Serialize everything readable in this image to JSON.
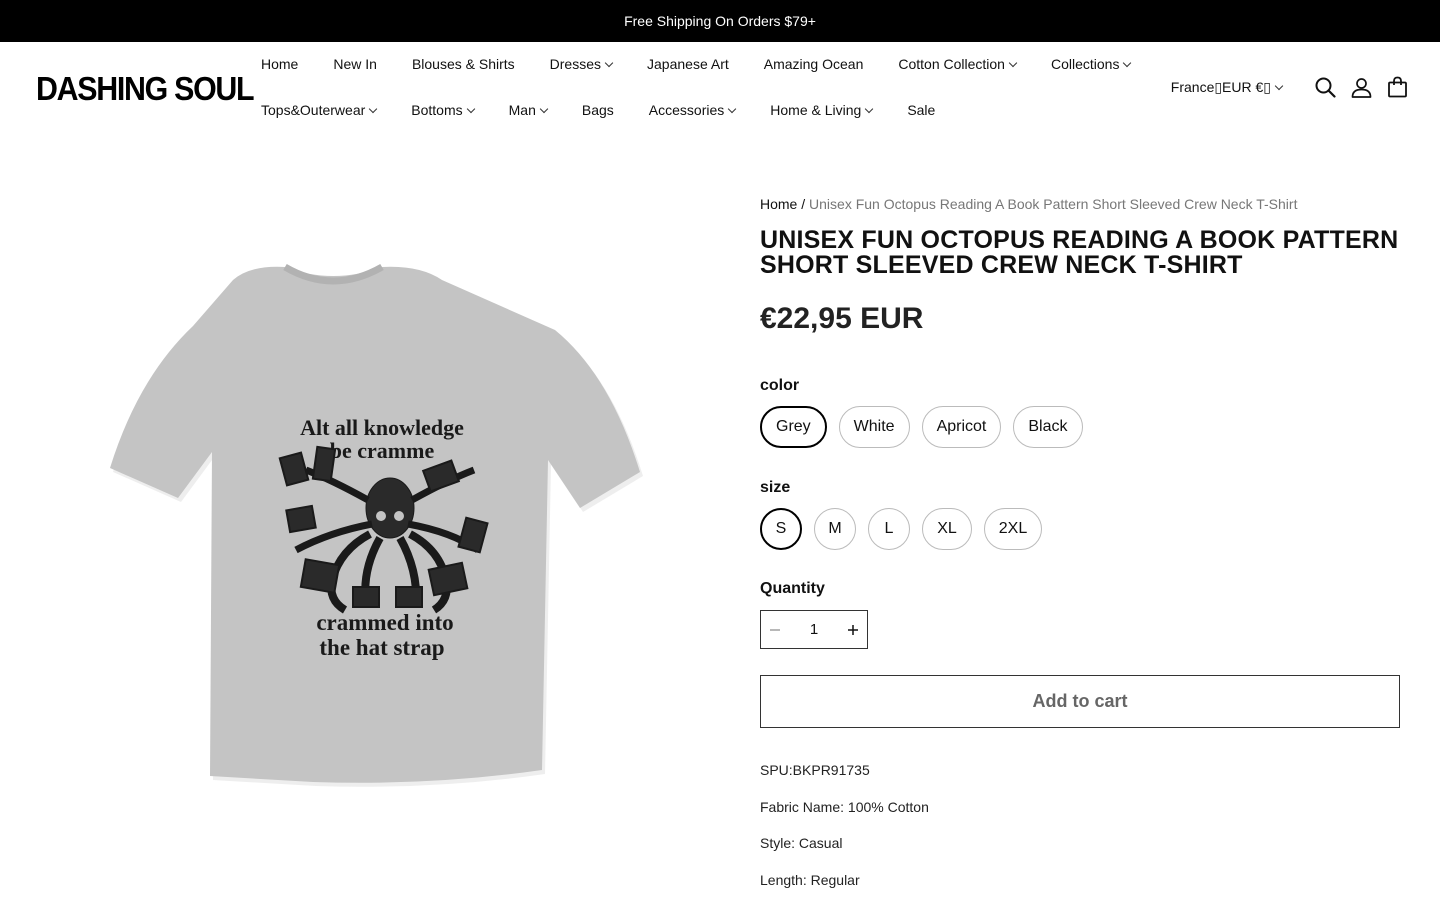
{
  "announcement": "Free Shipping On Orders $79+",
  "brand": {
    "logo_text": "DASHING SOUL"
  },
  "nav": {
    "row1": [
      {
        "label": "Home",
        "dropdown": false
      },
      {
        "label": "New In",
        "dropdown": false
      },
      {
        "label": "Blouses & Shirts",
        "dropdown": false
      },
      {
        "label": "Dresses",
        "dropdown": true
      },
      {
        "label": "Japanese Art",
        "dropdown": false
      },
      {
        "label": "Amazing Ocean",
        "dropdown": false
      },
      {
        "label": "Cotton Collection",
        "dropdown": true
      },
      {
        "label": "Collections",
        "dropdown": true
      }
    ],
    "row2": [
      {
        "label": "Tops&Outerwear",
        "dropdown": true
      },
      {
        "label": "Bottoms",
        "dropdown": true
      },
      {
        "label": "Man",
        "dropdown": true
      },
      {
        "label": "Bags",
        "dropdown": false
      },
      {
        "label": "Accessories",
        "dropdown": true
      },
      {
        "label": "Home & Living",
        "dropdown": true
      },
      {
        "label": "Sale",
        "dropdown": false
      }
    ]
  },
  "header": {
    "locale": "France▯EUR €▯",
    "icons": [
      "search-icon",
      "account-icon",
      "cart-icon"
    ]
  },
  "product": {
    "breadcrumb_home": "Home",
    "breadcrumb_sep": " / ",
    "breadcrumb_current": "Unisex Fun Octopus Reading A Book Pattern Short Sleeved Crew Neck T-Shirt",
    "title": "UNISEX FUN OCTOPUS READING A BOOK PATTERN SHORT SLEEVED CREW NECK T-SHIRT",
    "price": "€22,95 EUR",
    "image_text_top_1": "Alt all knowledge",
    "image_text_top_2": "be cramme",
    "image_text_bottom_1": "crammed into",
    "image_text_bottom_2": "the hat strap",
    "shirt_color": "#c4c4c4",
    "color_label": "color",
    "colors": [
      "Grey",
      "White",
      "Apricot",
      "Black"
    ],
    "selected_color": "Grey",
    "size_label": "size",
    "sizes": [
      "S",
      "M",
      "L",
      "XL",
      "2XL"
    ],
    "selected_size": "S",
    "quantity_label": "Quantity",
    "quantity": "1",
    "add_to_cart": "Add to cart",
    "specs": [
      "SPU:BKPR91735",
      "Fabric Name: 100% Cotton",
      "Style: Casual",
      "Length: Regular"
    ]
  }
}
